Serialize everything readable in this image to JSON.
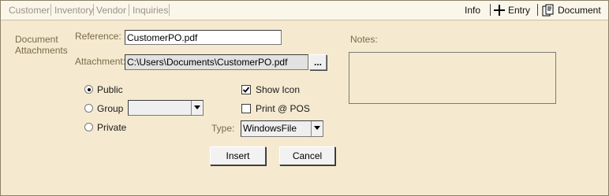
{
  "tabs": [
    "Customer",
    "Inventory",
    "Vendor",
    "Inquiries"
  ],
  "header_right": {
    "info": "Info",
    "entry": "Entry",
    "document": "Document"
  },
  "section_label": "Document Attachments",
  "reference": {
    "label": "Reference:",
    "value": "CustomerPO.pdf"
  },
  "attachment": {
    "label": "Attachment:",
    "value": "C:\\Users\\Documents\\CustomerPO.pdf",
    "browse": "..."
  },
  "notes_label": "Notes:",
  "visibility": {
    "public": "Public",
    "group": "Group",
    "private": "Private",
    "selected": "public",
    "group_value": ""
  },
  "options": {
    "show_icon": "Show Icon",
    "show_icon_checked": true,
    "print_pos": "Print @ POS",
    "print_pos_checked": false
  },
  "type": {
    "label": "Type:",
    "value": "WindowsFile"
  },
  "buttons": {
    "insert": "Insert",
    "cancel": "Cancel"
  }
}
